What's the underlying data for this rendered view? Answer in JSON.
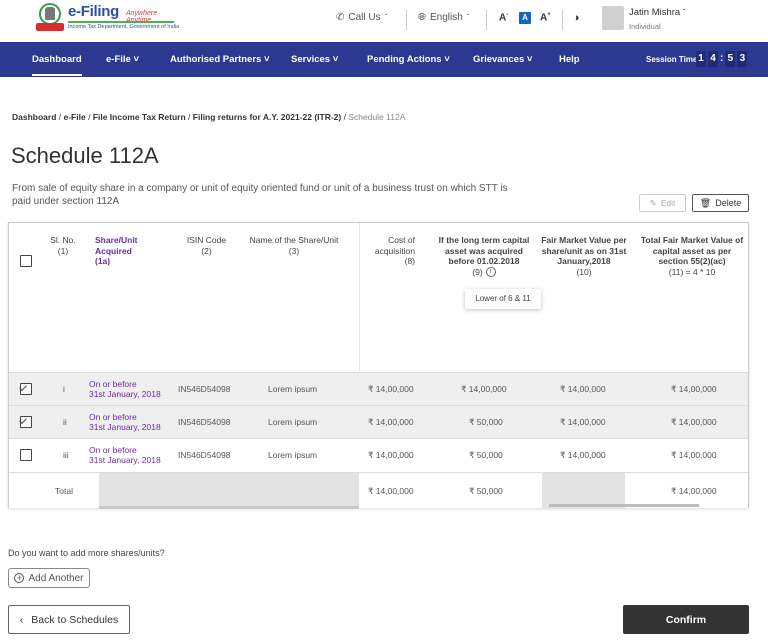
{
  "header": {
    "brand": "e-Filing",
    "tagline": "Anywhere Anytime",
    "department": "Income Tax Department, Government of India",
    "call_us": "Call Us",
    "language": "English",
    "font_decrease": "A",
    "font_normal": "A",
    "font_increase": "A",
    "user_name": "Jatin Mishra",
    "user_role": "Individual"
  },
  "nav": {
    "items": [
      {
        "label": "Dashboard",
        "active": true
      },
      {
        "label": "e-File ˅"
      },
      {
        "label": "Authorised Partners ˅"
      },
      {
        "label": "Services ˅"
      },
      {
        "label": "Pending Actions ˅"
      },
      {
        "label": "Grievances ˅"
      },
      {
        "label": "Help"
      }
    ],
    "session_label": "Session Time",
    "session_digits": [
      "1",
      "4",
      "5",
      "3"
    ],
    "session_sep": ":"
  },
  "breadcrumb": {
    "items": [
      "Dashboard",
      "e-File",
      "File Income Tax Return",
      "Filing returns for A.Y. 2021-22 (ITR-2)"
    ],
    "current": "Schedule 112A",
    "sep": " / "
  },
  "page": {
    "title": "Schedule 112A",
    "description": "From sale of equity share in a company or unit of equity oriented fund or unit of a business trust on which STT is paid under section 112A",
    "edit_label": "Edit",
    "delete_label": "Delete"
  },
  "table": {
    "headers": {
      "sl_no": {
        "title": "Sl. No.",
        "sub": "(1)"
      },
      "acquired": {
        "title": "Share/Unit Acquired",
        "sub": "(1a)"
      },
      "isin": {
        "title": "ISIN Code",
        "sub": "(2)"
      },
      "name": {
        "title": "Name of the Share/Unit",
        "sub": "(3)"
      },
      "cost": {
        "title": "Cost of acquisition",
        "sub": "(8)"
      },
      "lt_capital": {
        "title": "If the long term capital asset was acquired before 01.02.2018",
        "sub": "(9)"
      },
      "fmv": {
        "title": "Fair Market Value per share/unit as on 31st January,2018",
        "sub": "(10)"
      },
      "total_fmv": {
        "title": "Total Fair Market Value of capital asset as per section 55(2)(ac)",
        "sub": "(11) = 4 * 10"
      }
    },
    "tooltip": "Lower of 6 & 11",
    "rows": [
      {
        "checked": true,
        "sl": "i",
        "acq1": "On or before",
        "acq2": "31st January, 2018",
        "isin": "IN546D54098",
        "name": "Lorem ipsum",
        "cost": "₹ 14,00,000",
        "lt": "₹ 14,00,000",
        "fmv": "₹ 14,00,000",
        "total": "₹ 14,00,000"
      },
      {
        "checked": true,
        "sl": "ii",
        "acq1": "On or before",
        "acq2": "31st January, 2018",
        "isin": "IN546D54098",
        "name": "Lorem ipsum",
        "cost": "₹ 14,00,000",
        "lt": "₹ 50,000",
        "fmv": "₹ 14,00,000",
        "total": "₹ 14,00,000"
      },
      {
        "checked": false,
        "sl": "iii",
        "acq1": "On or before",
        "acq2": "31st January, 2018",
        "isin": "IN546D54098",
        "name": "Lorem ipsum",
        "cost": "₹ 14,00,000",
        "lt": "₹ 50,000",
        "fmv": "₹ 14,00,000",
        "total": "₹ 14,00,000"
      }
    ],
    "total": {
      "label": "Total",
      "cost": "₹ 14,00,000",
      "lt": "₹ 50,000",
      "total": "₹ 14,00,000"
    }
  },
  "footer": {
    "add_question": "Do you want to add more shares/units?",
    "add_label": "Add Another",
    "back_label": "Back to Schedules",
    "confirm_label": "Confirm"
  }
}
